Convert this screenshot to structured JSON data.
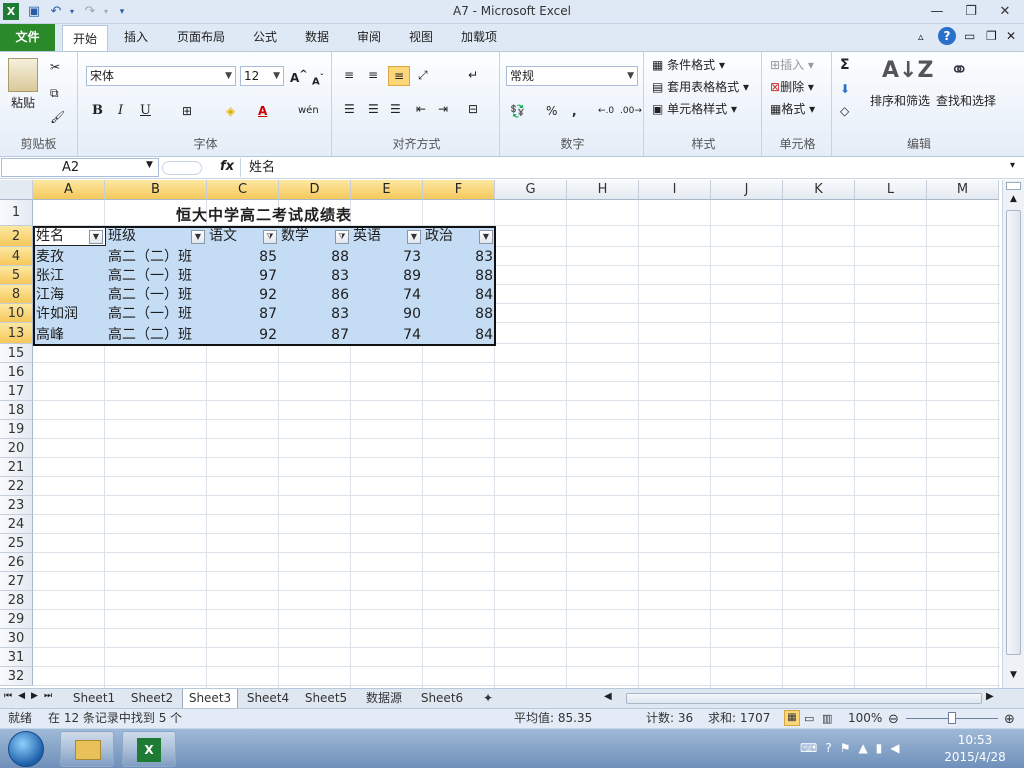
{
  "window": {
    "title": "A7  -  Microsoft Excel"
  },
  "tabs": [
    {
      "label": "文件"
    },
    {
      "label": "开始"
    },
    {
      "label": "插入"
    },
    {
      "label": "页面布局"
    },
    {
      "label": "公式"
    },
    {
      "label": "数据"
    },
    {
      "label": "审阅"
    },
    {
      "label": "视图"
    },
    {
      "label": "加载项"
    }
  ],
  "ribbon": {
    "clipboard": {
      "paste": "粘贴",
      "label": "剪贴板"
    },
    "font": {
      "name": "宋体",
      "size": "12",
      "label": "字体",
      "bold": "B",
      "italic": "I",
      "underline": "U"
    },
    "alignment": {
      "label": "对齐方式"
    },
    "number": {
      "format": "常规",
      "percent": "%",
      "comma": ",",
      "label": "数字"
    },
    "styles": {
      "conditional": "条件格式",
      "table": "套用表格格式",
      "cell": "单元格样式",
      "label": "样式"
    },
    "cells": {
      "insert": "插入",
      "delete": "删除",
      "format": "格式",
      "label": "单元格"
    },
    "editing": {
      "sum": "Σ",
      "sort": "排序和筛选",
      "find": "查找和选择",
      "label": "编辑"
    }
  },
  "formula_bar": {
    "cell_ref": "A2",
    "fx": "fx",
    "content": "姓名"
  },
  "columns": [
    "A",
    "B",
    "C",
    "D",
    "E",
    "F",
    "G",
    "H",
    "I",
    "J",
    "K",
    "L",
    "M"
  ],
  "rows": [
    "1",
    "2",
    "4",
    "5",
    "8",
    "10",
    "13",
    "15",
    "16",
    "17",
    "18",
    "19",
    "20",
    "21",
    "22",
    "23",
    "24",
    "25",
    "26",
    "27",
    "28",
    "29",
    "30",
    "31",
    "32"
  ],
  "sheet_title": "恒大中学高二考试成绩表",
  "table": {
    "headers": [
      "姓名",
      "班级",
      "语文",
      "数学",
      "英语",
      "政治"
    ],
    "rows": [
      [
        "麦孜",
        "高二（二）班",
        "85",
        "88",
        "73",
        "83"
      ],
      [
        "张江",
        "高二（一）班",
        "97",
        "83",
        "89",
        "88"
      ],
      [
        "江海",
        "高二（一）班",
        "92",
        "86",
        "74",
        "84"
      ],
      [
        "许如润",
        "高二（一）班",
        "87",
        "83",
        "90",
        "88"
      ],
      [
        "高峰",
        "高二（二）班",
        "92",
        "87",
        "74",
        "84"
      ]
    ]
  },
  "sheets": [
    "Sheet1",
    "Sheet2",
    "Sheet3",
    "Sheet4",
    "Sheet5",
    "数据源",
    "Sheet6"
  ],
  "status": {
    "mode": "就绪",
    "filter_msg": "在 12 条记录中找到 5 个",
    "average": "平均值: 85.35",
    "count": "计数: 36",
    "sum": "求和: 1707",
    "zoom": "100%"
  },
  "clock": {
    "time": "10:53",
    "date": "2015/4/28"
  }
}
